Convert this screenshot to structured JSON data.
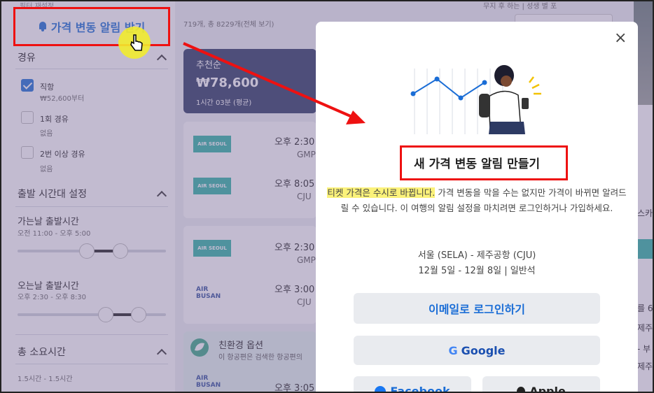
{
  "sidebar": {
    "top_tiny": "필터 재설정",
    "alert_button": "가격 변동 알림 받기",
    "stops_title": "경유",
    "options": [
      {
        "label": "직항",
        "sub": "₩52,600부터",
        "checked": true
      },
      {
        "label": "1회 경유",
        "sub": "없음",
        "checked": false
      },
      {
        "label": "2번 이상 경유",
        "sub": "없음",
        "checked": false
      }
    ],
    "time_title": "출발 시간대 설정",
    "outbound_label": "가는날 출발시간",
    "outbound_range": "오전 11:00 - 오후 5:00",
    "return_label": "오는날 출발시간",
    "return_range": "오후 2:30 - 오후 8:30",
    "duration_title": "총 소요시간",
    "duration_range": "1.5시간 - 1.5시간"
  },
  "results": {
    "count": "719개, 총 8229개(전체 보기)",
    "recommend": {
      "title": "추천순",
      "price": "₩78,600",
      "detail": "1시간 03분 (평균)"
    },
    "cards": [
      {
        "rows": [
          {
            "airline": "AIR SEOUL",
            "time": "오후 2:30",
            "airport": "GMP"
          },
          {
            "airline": "AIR SEOUL",
            "time": "오후 8:05",
            "airport": "CJU"
          }
        ]
      },
      {
        "rows": [
          {
            "airline": "AIR SEOUL",
            "time": "오후 2:30",
            "airport": "GMP"
          },
          {
            "airline": "AIR BUSAN",
            "time": "오후 3:00",
            "airport": "CJU"
          }
        ]
      }
    ],
    "eco_title": "친환경 옵션",
    "eco_sub": "이 항공편은 검색한 항공편의",
    "last_time": "오후 3:05",
    "last_airline": "AIR BUSAN"
  },
  "right": {
    "top_text": "무지 후 하는 | 성생 별 포",
    "snippets": [
      "스카",
      "를 6",
      "제주",
      "- 부",
      "제주"
    ]
  },
  "modal": {
    "close": "×",
    "title": "새 가격 변동 알림 만들기",
    "highlight": "티켓 가격은 수시로 바뀝니다.",
    "desc_rest": " 가격 변동을 막을 수는 없지만 가격이 바뀌면 알려드릴 수 있습니다. 이 여행의 알림 설정을 마치려면 로그인하거나 가입하세요.",
    "route": "서울 (SELA) - 제주공항 (CJU)",
    "dates": "12월 5일 - 12월 8일 | 일반석",
    "email_button": "이메일로 로그인하기",
    "google_button": "Google",
    "facebook_button": "Facebook",
    "apple_button": "Apple"
  },
  "colors": {
    "accent": "#1a6dd6",
    "annotation": "#e11111",
    "highlight": "#fbf27a",
    "chart_line": "#1a6dd6"
  }
}
